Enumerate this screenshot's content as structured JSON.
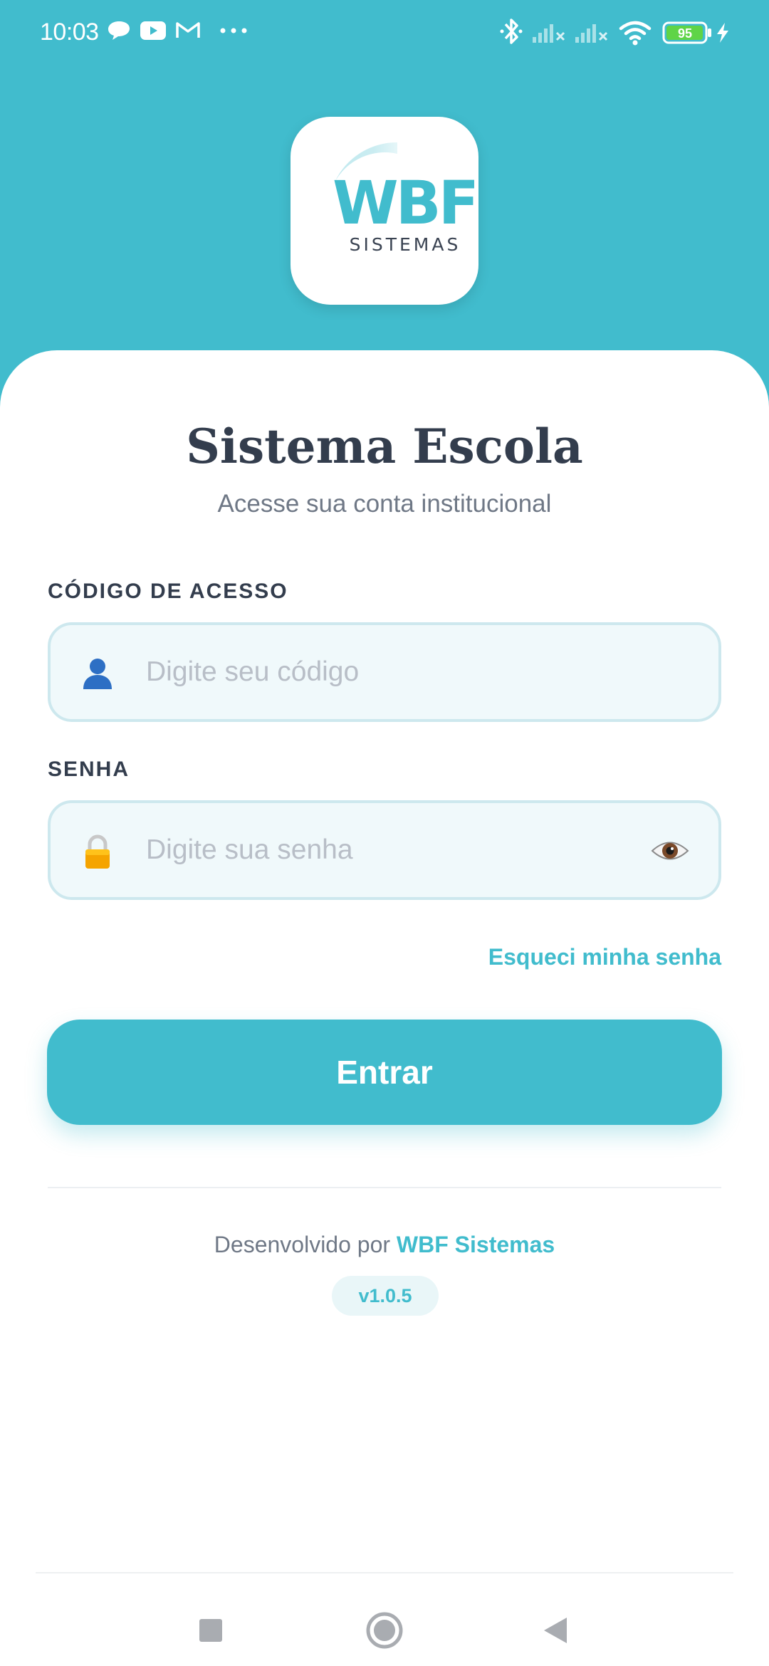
{
  "status_bar": {
    "time": "10:03",
    "battery_level": "95",
    "icons": [
      "chat-bubble-icon",
      "youtube-icon",
      "gmail-icon",
      "more-dots-icon",
      "bluetooth-icon",
      "signal-icon",
      "signal-icon",
      "wifi-icon",
      "battery-icon",
      "charging-icon"
    ]
  },
  "header": {
    "logo_text": "WBF",
    "logo_subtext": "SISTEMAS"
  },
  "login": {
    "title": "Sistema Escola",
    "subtitle": "Acesse sua conta institucional",
    "access_code": {
      "label": "CÓDIGO DE ACESSO",
      "placeholder": "Digite seu código",
      "value": "",
      "icon": "user-icon"
    },
    "password": {
      "label": "SENHA",
      "placeholder": "Digite sua senha",
      "value": "",
      "icon": "lock-icon",
      "toggle_icon": "eye-icon"
    },
    "forgot_label": "Esqueci minha senha",
    "submit_label": "Entrar"
  },
  "footer": {
    "developed_by_prefix": "Desenvolvido por",
    "developer_name": "WBF Sistemas",
    "version": "v1.0.5"
  },
  "nav_bar": {
    "buttons": [
      "recents-square-icon",
      "home-circle-icon",
      "back-triangle-icon"
    ]
  },
  "colors": {
    "primary": "#41bccd",
    "text_dark": "#333d4d",
    "text_muted": "#6f7886",
    "input_bg": "#f0f9fb",
    "input_border": "#cde8ee"
  }
}
